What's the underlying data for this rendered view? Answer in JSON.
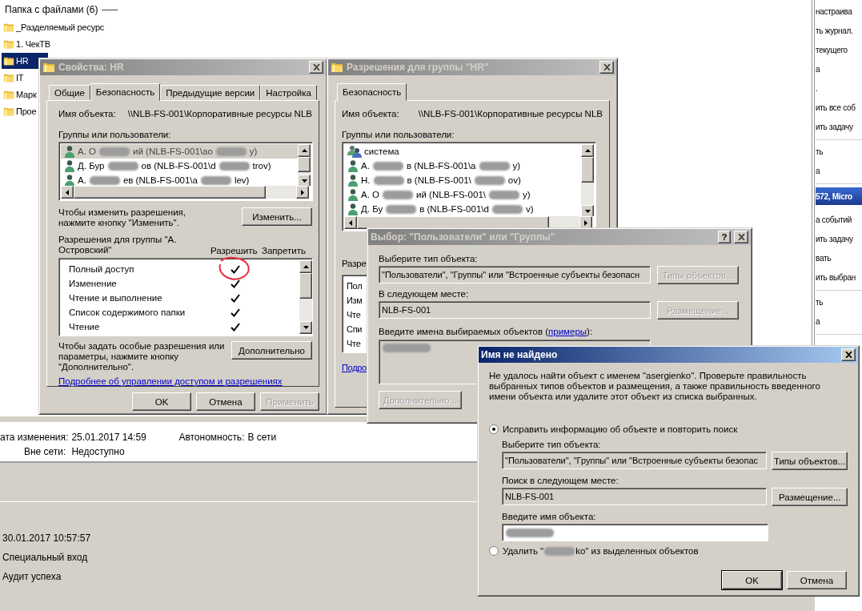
{
  "explorer": {
    "group_header": "Папка с файлами (6)",
    "folders": [
      {
        "name": "_Разделяемый ресурс",
        "selected": false
      },
      {
        "name": "1. ЧекТВ",
        "selected": false
      },
      {
        "name": "HR",
        "selected": true
      },
      {
        "name": "IT",
        "selected": false
      },
      {
        "name": "Марк",
        "selected": false
      },
      {
        "name": "Прое",
        "selected": false
      }
    ],
    "details": [
      {
        "label": "ата изменения:",
        "value": "25.01.2017 14:59"
      },
      {
        "label": "Автономность:",
        "value": "В сети"
      },
      {
        "label": "Вне сети:",
        "value": "Недоступно"
      }
    ]
  },
  "event_details": [
    "30.01.2017 10:57:57",
    "Специальный вход",
    "Аудит успеха"
  ],
  "actions_pane": {
    "blocks": [
      {
        "kind": "items",
        "items": [
          "настраива",
          "ть журнал.",
          "текущего",
          "а",
          ".",
          "ить все соб",
          "ить задачу"
        ]
      },
      {
        "kind": "items",
        "items": [
          "ть",
          "а"
        ]
      },
      {
        "kind": "header",
        "text": "572, Micro"
      },
      {
        "kind": "items",
        "items": [
          "а событий",
          "ить задачу",
          "вать",
          "ить выбран"
        ]
      },
      {
        "kind": "items",
        "items": [
          "ть",
          "а"
        ]
      }
    ]
  },
  "properties": {
    "title": "Свойства: HR",
    "active": false,
    "tabs": [
      {
        "label": "Общие",
        "selected": false
      },
      {
        "label": "Безопасность",
        "selected": true
      },
      {
        "label": "Предыдущие версии",
        "selected": false
      },
      {
        "label": "Настройка",
        "selected": false
      }
    ],
    "object_label": "Имя объекта:",
    "object_value": "\\\\NLB-FS-001\\Корпоративные ресурсы NLB",
    "groups_label": "Группы или пользователи:",
    "users": [
      {
        "kind": "user",
        "parts": [
          "А. О",
          "ий (NLB-FS-001\\ao",
          "y)"
        ],
        "selected": true
      },
      {
        "kind": "user",
        "parts": [
          "Д. Бур",
          "ов (NLB-FS-001\\d",
          "trov)"
        ],
        "selected": false
      },
      {
        "kind": "user",
        "parts": [
          "А.",
          "ев (NLB-FS-001\\a",
          "lev)"
        ],
        "selected": false
      }
    ],
    "change_hint": "Чтобы изменить разрешения, нажмите кнопку \"Изменить\".",
    "change_button": "Изменить...",
    "perm_label": "Разрешения для группы \"А. Островский\"",
    "allow_header": "Разрешить",
    "deny_header": "Запретить",
    "permissions": [
      {
        "name": "Полный доступ",
        "allow": true,
        "deny": false,
        "circled": true
      },
      {
        "name": "Изменение",
        "allow": true,
        "deny": false,
        "circled": false
      },
      {
        "name": "Чтение и выполнение",
        "allow": true,
        "deny": false,
        "circled": false
      },
      {
        "name": "Список содержимого папки",
        "allow": true,
        "deny": false,
        "circled": false
      },
      {
        "name": "Чтение",
        "allow": true,
        "deny": false,
        "circled": false
      }
    ],
    "advanced_hint": "Чтобы задать особые разрешения или параметры, нажмите кнопку \"Дополнительно\".",
    "advanced_button": "Дополнительно",
    "help_link": "Подробнее об управлении доступом и разрешениях",
    "buttons": [
      {
        "label": "OK",
        "disabled": false
      },
      {
        "label": "Отмена",
        "disabled": false
      },
      {
        "label": "Применить",
        "disabled": true
      }
    ]
  },
  "group_permissions": {
    "title": "Разрешения для группы \"HR\"",
    "active": false,
    "tabs": [
      {
        "label": "Безопасность",
        "selected": true
      }
    ],
    "object_label": "Имя объекта:",
    "object_value": "\\\\NLB-FS-001\\Корпоративные ресурсы NLB",
    "groups_label": "Группы или пользователи:",
    "users": [
      {
        "kind": "group",
        "parts": [
          "система"
        ],
        "selected": false
      },
      {
        "kind": "user",
        "parts": [
          "А.",
          "в (NLB-FS-001\\a",
          "y)"
        ],
        "selected": false
      },
      {
        "kind": "user",
        "parts": [
          "Н.",
          "в (NLB-FS-001\\",
          "ov)"
        ],
        "selected": false
      },
      {
        "kind": "user",
        "parts": [
          "А. О",
          "ий (NLB-FS-001\\",
          "y)"
        ],
        "selected": false
      },
      {
        "kind": "user",
        "parts": [
          "Д. Бу",
          "в (NLB-FS-001\\d",
          "v)"
        ],
        "selected": false
      }
    ],
    "perm_label": "Разре",
    "permissions": [
      "Пол",
      "Изм",
      "Чте",
      "Спи",
      "Чте"
    ],
    "help_link": "Подро"
  },
  "select_dialog": {
    "title": "Выбор: \"Пользователи\" или \"Группы\"",
    "active": false,
    "help_button": "?",
    "type_label": "Выберите тип объекта:",
    "type_value": "\"Пользователи\", \"Группы\" или \"Встроенные субъекты безопасн",
    "type_button": {
      "label": "Типы объектов...",
      "disabled": true
    },
    "location_label": "В следующем месте:",
    "location_value": "NLB-FS-001",
    "location_button": {
      "label": "Размещение...",
      "disabled": true
    },
    "names_label_before": "Введите имена выбираемых объектов (",
    "examples_link": "примеры",
    "names_label_after": "):",
    "advanced_button": {
      "label": "Дополнительно...",
      "disabled": true
    }
  },
  "not_found": {
    "title": "Имя не найдено",
    "active": true,
    "message": "Не удалось найти объект с именем \"asergienko\". Проверьте правильность выбранных типов объектов и размещения, а также правильность введенного имени объекта или удалите этот объект из списка выбранных.",
    "options": [
      {
        "kind": "correct",
        "parts": [
          "Исправить информацию об объекте и повторить поиск"
        ],
        "selected": true
      },
      {
        "kind": "remove",
        "parts": [
          "Удалить \"",
          "ko\" из выделенных объектов"
        ],
        "selected": false
      }
    ],
    "type_label": "Выберите тип объекта:",
    "type_value": "\"Пользователи\", \"Группы\" или \"Встроенные субъекты безопас",
    "type_button": {
      "label": "Типы объектов...",
      "disabled": false
    },
    "location_label": "Поиск в следующем месте:",
    "location_value": "NLB-FS-001",
    "location_button": {
      "label": "Размещение...",
      "disabled": false
    },
    "name_label": "Введите имя объекта:",
    "buttons": [
      {
        "label": "OK",
        "default": true
      },
      {
        "label": "Отмена",
        "default": false
      }
    ]
  }
}
